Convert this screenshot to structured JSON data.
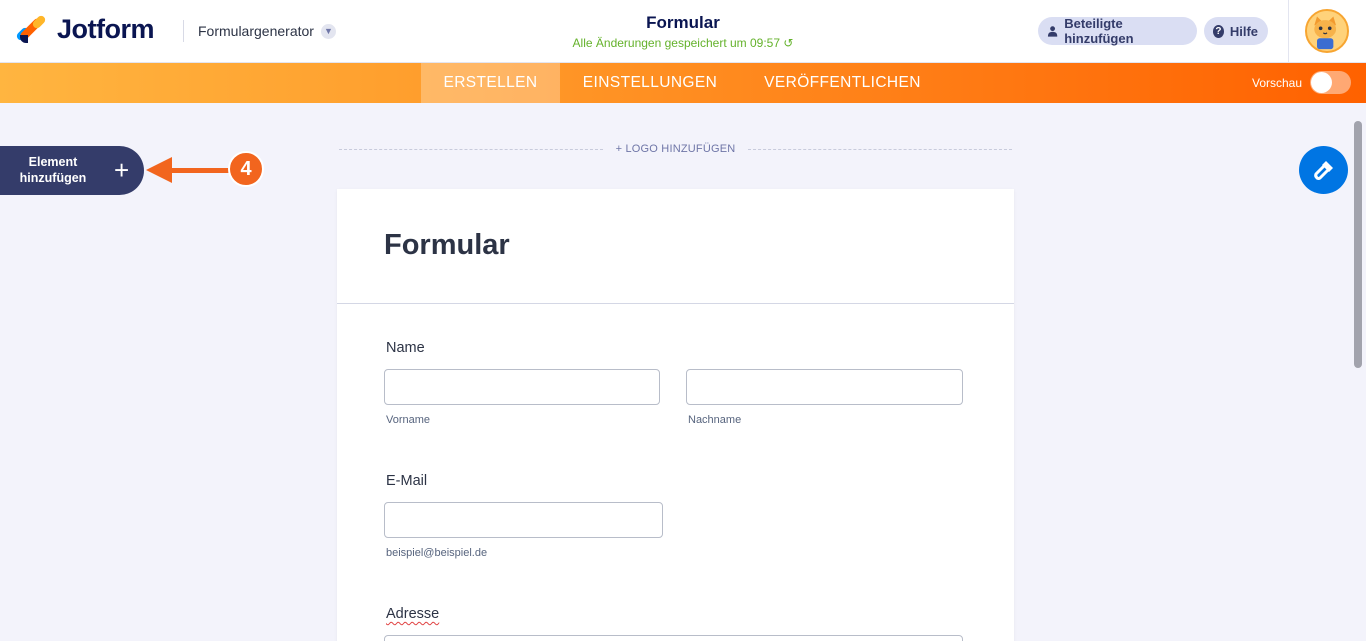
{
  "header": {
    "brand": "Jotform",
    "generator_label": "Formulargenerator",
    "form_title": "Formular",
    "save_status": "Alle Änderungen gespeichert um 09:57",
    "share_button": "Beteiligte hinzufügen",
    "help_button": "Hilfe"
  },
  "nav": {
    "tabs": [
      {
        "label": "ERSTELLEN",
        "active": true
      },
      {
        "label": "EINSTELLUNGEN",
        "active": false
      },
      {
        "label": "VERÖFFENTLICHEN",
        "active": false
      }
    ],
    "preview_label": "Vorschau",
    "preview_enabled": false
  },
  "sidebar": {
    "add_element_line1": "Element",
    "add_element_line2": "hinzufügen",
    "step_number": "4"
  },
  "canvas": {
    "add_logo": "+ LOGO HINZUFÜGEN"
  },
  "form": {
    "title": "Formular",
    "fields": {
      "name": {
        "label": "Name",
        "first_sublabel": "Vorname",
        "last_sublabel": "Nachname"
      },
      "email": {
        "label": "E-Mail",
        "sublabel": "beispiel@beispiel.de"
      },
      "address": {
        "label": "Adresse"
      }
    }
  },
  "colors": {
    "brand_navy": "#0a1551",
    "accent_orange": "#ff6100",
    "save_green": "#64b22b",
    "design_blue": "#0075e3"
  }
}
